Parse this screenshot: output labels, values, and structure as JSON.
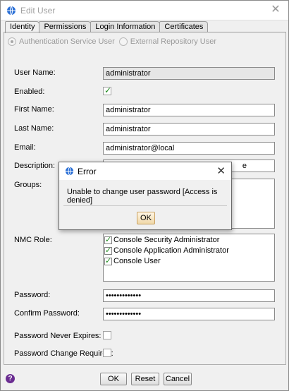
{
  "window": {
    "title": "Edit User"
  },
  "tabs": [
    {
      "label": "Identity"
    },
    {
      "label": "Permissions"
    },
    {
      "label": "Login Information"
    },
    {
      "label": "Certificates"
    }
  ],
  "auth_source": {
    "options": [
      "Authentication Service User",
      "External Repository User"
    ],
    "selected": "Authentication Service User"
  },
  "form": {
    "user_name_label": "User Name:",
    "user_name_value": "administrator",
    "enabled_label": "Enabled:",
    "enabled_checked": true,
    "first_name_label": "First Name:",
    "first_name_value": "administrator",
    "last_name_label": "Last Name:",
    "last_name_value": "administrator",
    "email_label": "Email:",
    "email_value": "administrator@local",
    "description_label": "Description:",
    "description_value_visible": "e",
    "groups_label": "Groups:",
    "nmc_role_label": "NMC Role:",
    "nmc_roles": [
      {
        "label": "Console Security Administrator",
        "checked": true
      },
      {
        "label": "Console Application Administrator",
        "checked": true
      },
      {
        "label": "Console User",
        "checked": true
      }
    ],
    "password_label": "Password:",
    "password_value": "•••••••••••••",
    "confirm_password_label": "Confirm Password:",
    "confirm_password_value": "•••••••••••••",
    "never_expires_label": "Password Never Expires:",
    "change_required_label": "Password Change Required:"
  },
  "buttons": {
    "ok": "OK",
    "reset": "Reset",
    "cancel": "Cancel"
  },
  "error_dialog": {
    "title": "Error",
    "message": "Unable to change user password [Access is denied]",
    "ok": "OK"
  },
  "icons": {
    "app": "globe-icon",
    "help": "help-icon",
    "close": "close-icon",
    "check": "check-icon"
  },
  "colors": {
    "check": "#1a8a1a",
    "help": "#6a2c91",
    "dialog_ok_border": "#c8a060"
  }
}
